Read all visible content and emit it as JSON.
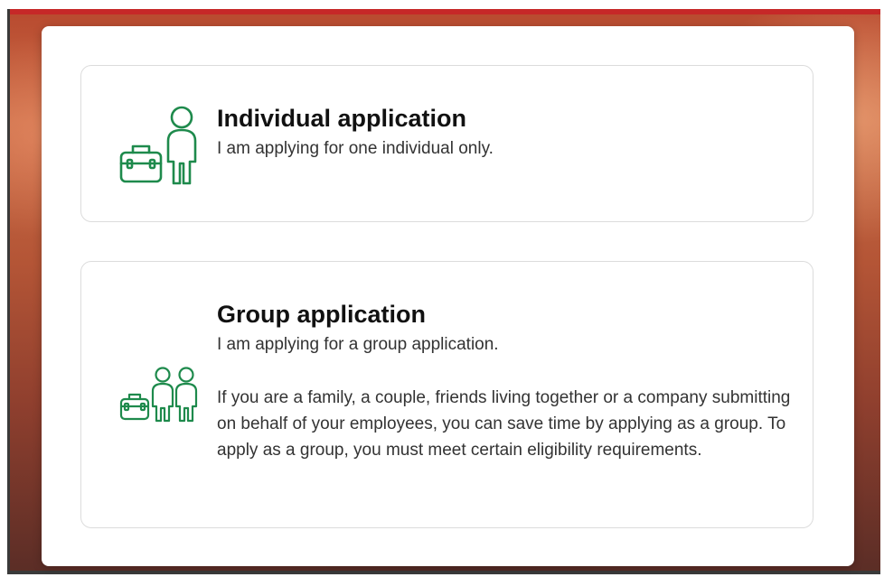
{
  "colors": {
    "icon_green": "#1e8a4c",
    "accent_red": "#c62828",
    "card_border": "#dcdcdc",
    "title_text": "#111111",
    "body_text": "#333333"
  },
  "options": [
    {
      "id": "individual",
      "icon": "individual-with-briefcase-icon",
      "title": "Individual application",
      "subtitle": "I am applying for one individual only.",
      "description": ""
    },
    {
      "id": "group",
      "icon": "group-with-briefcase-icon",
      "title": "Group application",
      "subtitle": "I am applying for a group application.",
      "description": "If you are a family, a couple, friends living together or a company submitting on behalf of your employees, you can save time by applying as a group. To apply as a group, you must meet certain eligibility requirements."
    }
  ]
}
